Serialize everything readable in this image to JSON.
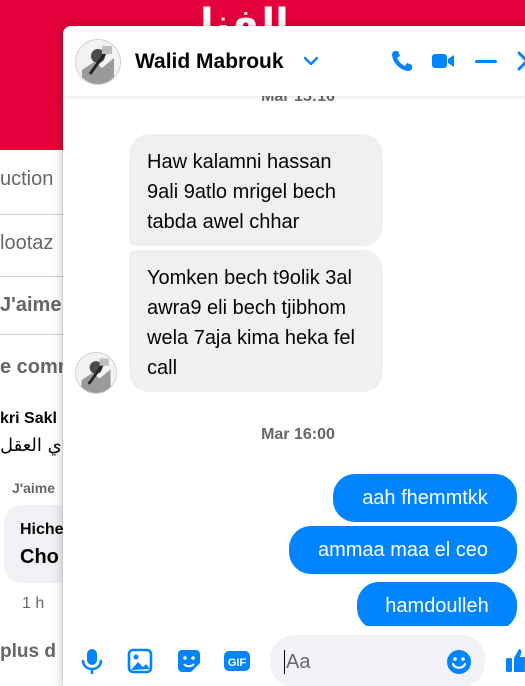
{
  "background": {
    "banner_text": "الفنا",
    "items": [
      "uction",
      "lootaz",
      "J'aime",
      "e comm",
      "kri Sakl",
      "ي العقل",
      "J'aime",
      "Hiche",
      "Cho",
      "1 h",
      "plus d"
    ]
  },
  "header": {
    "contact_name": "Walid Mabrouk"
  },
  "messages": {
    "top_timestamp": "Mar 15:16",
    "incoming": [
      "Haw kalamni hassan 9ali 9atlo mrigel bech tabda awel chhar",
      "Yomken bech t9olik 3al awra9 eli bech tjibhom wela 7aja kima heka fel call"
    ],
    "separator": "Mar 16:00",
    "outgoing": [
      "aah fhemmtkk",
      "ammaa maa el ceo",
      "hamdoulleh"
    ]
  },
  "composer": {
    "placeholder": "Aa",
    "value": ""
  },
  "colors": {
    "accent": "#0084ff",
    "banner": "#e4003a",
    "incoming_bubble": "#f0f0f0"
  },
  "icons": [
    "phone-icon",
    "video-icon",
    "minimize-icon",
    "close-icon",
    "mic-icon",
    "photo-icon",
    "sticker-icon",
    "gif-icon",
    "emoji-icon",
    "like-icon"
  ]
}
